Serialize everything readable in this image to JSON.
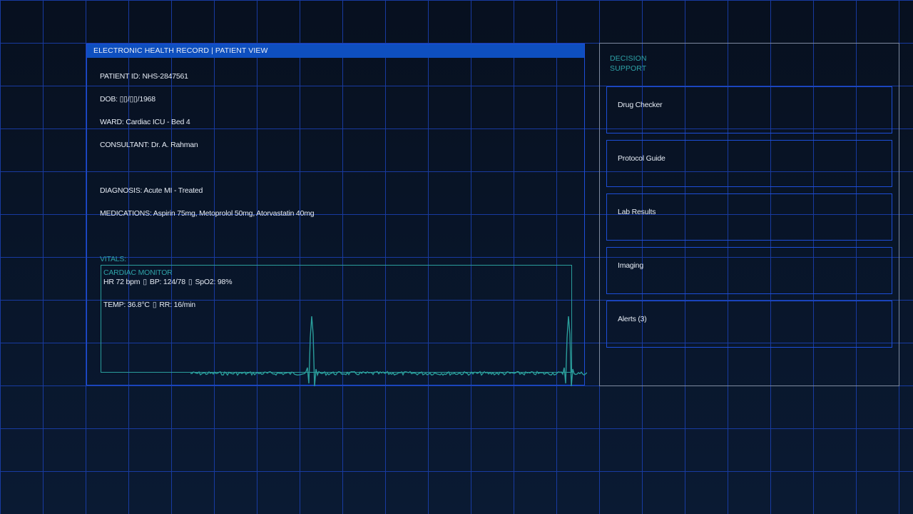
{
  "colors": {
    "background": "#07101f",
    "grid": "#1a3fae",
    "header": "#0e4fbf",
    "accent_teal": "#2fa3a8",
    "text": "#e6ecf5"
  },
  "record": {
    "title": "ELECTRONIC HEALTH RECORD | PATIENT VIEW",
    "patient_id": "PATIENT ID: NHS-2847561",
    "dob": "DOB: ▯▯/▯▯/1968",
    "ward": "WARD: Cardiac ICU - Bed 4",
    "consultant": "CONSULTANT: Dr. A. Rahman",
    "diagnosis": "DIAGNOSIS: Acute MI - Treated",
    "medications": "MEDICATIONS: Aspirin 75mg, Metoprolol 50mg, Atorvastatin 40mg"
  },
  "vitals": {
    "label": "VITALS:",
    "monitor_label": "CARDIAC MONITOR",
    "hr": "HR 72 bpm",
    "bp": "BP: 124/78",
    "spo2": "SpO2: 98%",
    "temp": "TEMP: 36.8°C",
    "rr": "RR: 16/min",
    "separator": "▯"
  },
  "decision_support": {
    "title": "DECISION SUPPORT",
    "buttons": [
      {
        "label": "Drug Checker"
      },
      {
        "label": "Protocol Guide"
      },
      {
        "label": "Lab Results"
      },
      {
        "label": "Imaging"
      },
      {
        "label": "Alerts (3)"
      }
    ]
  }
}
